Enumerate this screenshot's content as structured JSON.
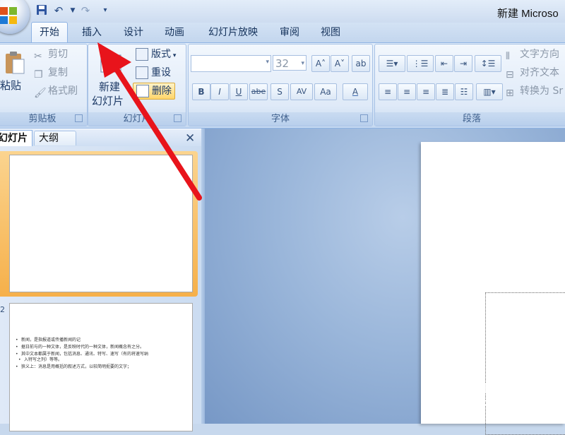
{
  "window": {
    "title": "新建 Microso"
  },
  "quick_access": {
    "save": "💾",
    "undo": "↶",
    "redo": "↷"
  },
  "tabs": [
    {
      "label": "开始"
    },
    {
      "label": "插入"
    },
    {
      "label": "设计"
    },
    {
      "label": "动画"
    },
    {
      "label": "幻灯片放映"
    },
    {
      "label": "审阅"
    },
    {
      "label": "视图"
    }
  ],
  "ribbon": {
    "clipboard": {
      "label": "剪贴板",
      "paste": "粘贴",
      "cut": "剪切",
      "copy": "复制",
      "format_painter": "格式刷"
    },
    "slides": {
      "label": "幻灯片",
      "new_slide_line1": "新建",
      "new_slide_line2": "幻灯片",
      "layout": "版式",
      "reset": "重设",
      "delete": "删除"
    },
    "font": {
      "label": "字体",
      "font_name": "",
      "font_size": "32",
      "buttons": [
        "B",
        "I",
        "U",
        "abe",
        "S",
        "AV",
        "Aa",
        "A"
      ]
    },
    "paragraph": {
      "label": "段落",
      "text_direction": "文字方向",
      "align_text": "对齐文本",
      "convert": "转换为 Sr"
    }
  },
  "pane": {
    "tab_slides": "幻灯片",
    "tab_outline": "大纲",
    "close": "✕",
    "thumb2_number": "2",
    "thumb2_bullets": [
      "新闻，是指报道或传播新闻的记",
      "据日前与的一种文体，是反映时代的一种文体，新闻概念有之分。",
      "其中文本都属于新闻，包括消息、通讯、特写、速写（有的将速写纳",
      "入特写之列）等等。",
      "狭义上：消息是用概括的叙述方式，以较简明扼要的文字；"
    ]
  },
  "watermark": {
    "main": "Bai du 经验",
    "sub": "jingyan.baidu.com"
  },
  "colors": {
    "accent_arrow": "#e8141b",
    "ribbon_border": "#8db2e3",
    "selected_slide": "#f6b04a"
  }
}
